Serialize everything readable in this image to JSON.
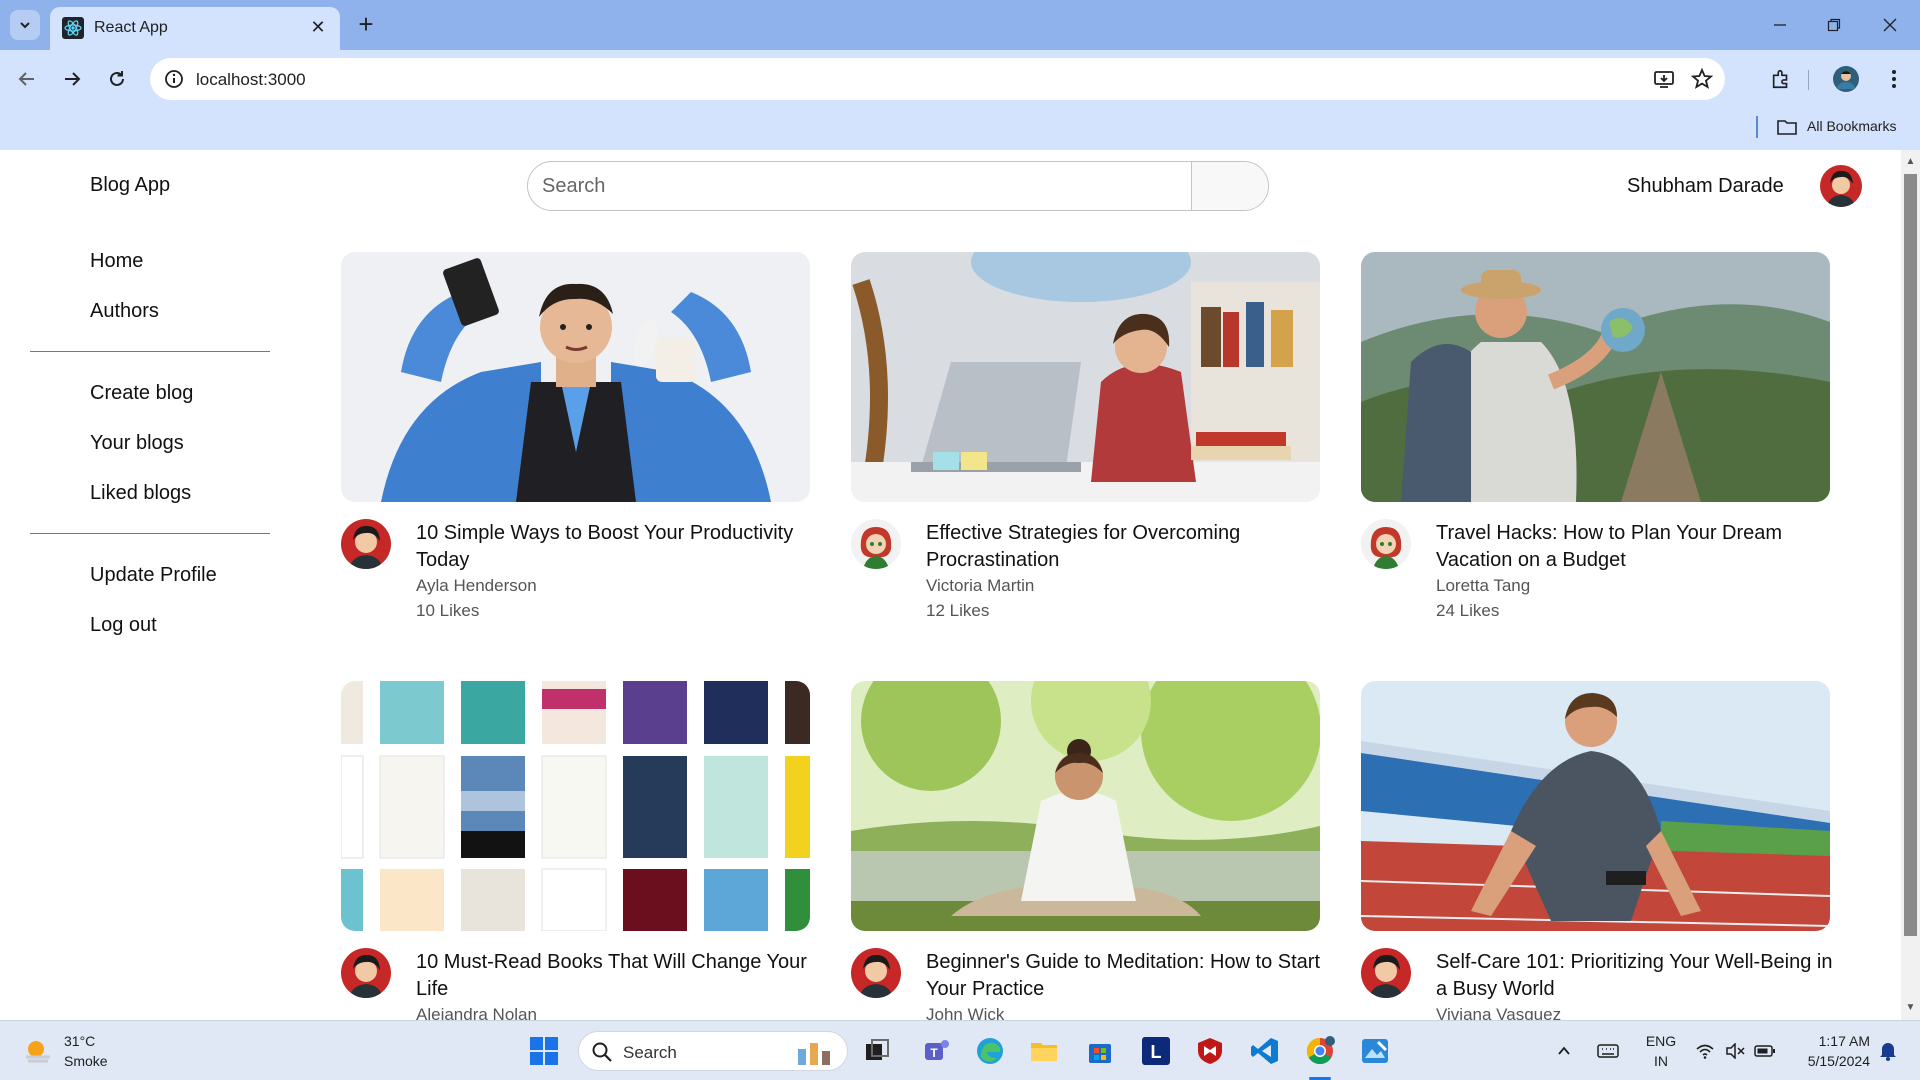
{
  "browser": {
    "tab_title": "React App",
    "url": "localhost:3000",
    "bookmarks_label": "All Bookmarks"
  },
  "header": {
    "logo": "Blog App",
    "search_placeholder": "Search",
    "user_name": "Shubham Darade"
  },
  "sidebar": {
    "group1": [
      "Home",
      "Authors"
    ],
    "group2": [
      "Create blog",
      "Your blogs",
      "Liked blogs"
    ],
    "group3": [
      "Update Profile",
      "Log out"
    ]
  },
  "blogs": [
    {
      "title": "10 Simple Ways to Boost Your Productivity Today",
      "author": "Ayla Henderson",
      "likes": "10 Likes",
      "image": "productivity-image"
    },
    {
      "title": "Effective Strategies for Overcoming Procrastination",
      "author": "Victoria Martin",
      "likes": "12 Likes",
      "image": "procrastination-image"
    },
    {
      "title": "Travel Hacks: How to Plan Your Dream Vacation on a Budget",
      "author": "Loretta Tang",
      "likes": "24 Likes",
      "image": "travel-image"
    },
    {
      "title": "10 Must-Read Books That Will Change Your Life",
      "author": "Alejandra Nolan",
      "likes": "",
      "image": "books-image"
    },
    {
      "title": "Beginner's Guide to Meditation: How to Start Your Practice",
      "author": "John Wick",
      "likes": "",
      "image": "meditation-image"
    },
    {
      "title": "Self-Care 101: Prioritizing Your Well-Being in a Busy World",
      "author": "Viviana Vasquez",
      "likes": "",
      "image": "running-image"
    }
  ],
  "taskbar": {
    "temperature": "31°C",
    "condition": "Smoke",
    "search_label": "Search",
    "lang_top": "ENG",
    "lang_bottom": "IN",
    "time": "1:17 AM",
    "date": "5/15/2024"
  },
  "colors": {
    "tabstrip": "#8fb2ec",
    "toolbar": "#d3e3fd",
    "taskbar": "#dfe8f4"
  }
}
